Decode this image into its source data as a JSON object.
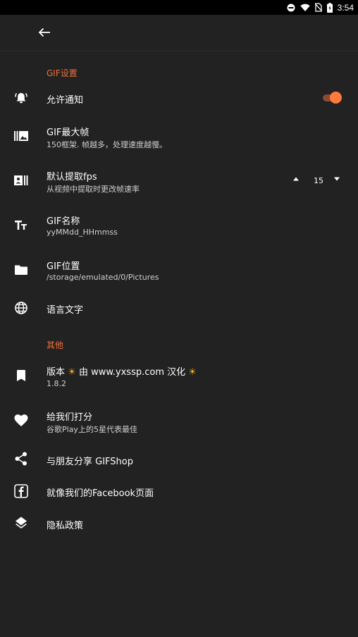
{
  "status_bar": {
    "time": "3:54"
  },
  "sections": {
    "gif_settings": "GIF设置",
    "other": "其他"
  },
  "settings": {
    "notify": {
      "title": "允许通知",
      "enabled": true
    },
    "max_frames": {
      "title": "GIF最大帧",
      "sub": "150框架. 帧越多，处理速度越慢。"
    },
    "fps": {
      "title": "默认提取fps",
      "sub": "从视频中提取时更改帧速率",
      "value": "15"
    },
    "name": {
      "title": "GIF名称",
      "sub": "yyMMdd_HHmmss"
    },
    "location": {
      "title": "GIF位置",
      "sub": "/storage/emulated/0/Pictures"
    },
    "language": {
      "title": "语言文字"
    }
  },
  "other": {
    "version": {
      "title_pre": "版本",
      "title_mid": "由 www.yxssp.com 汉化",
      "sub": "1.8.2"
    },
    "rate": {
      "title": "给我们打分",
      "sub": "谷歌Play上的5星代表最佳"
    },
    "share": {
      "title": "与朋友分享 GIFShop"
    },
    "facebook": {
      "title": "就像我们的Facebook页面"
    },
    "privacy": {
      "title": "隐私政策"
    }
  },
  "colors": {
    "accent": "#f0703a",
    "background": "#222222",
    "statusbar": "#000000"
  },
  "icons": [
    "dnd-icon",
    "wifi-icon",
    "no-sim-icon",
    "battery-icon",
    "back-arrow-icon",
    "bell-ring-icon",
    "frames-icon",
    "fps-icon",
    "text-size-icon",
    "folder-icon",
    "globe-icon",
    "bookmark-icon",
    "heart-icon",
    "share-icon",
    "facebook-icon",
    "layers-icon",
    "sun-emoji-icon",
    "arrow-up-icon",
    "arrow-down-icon"
  ]
}
